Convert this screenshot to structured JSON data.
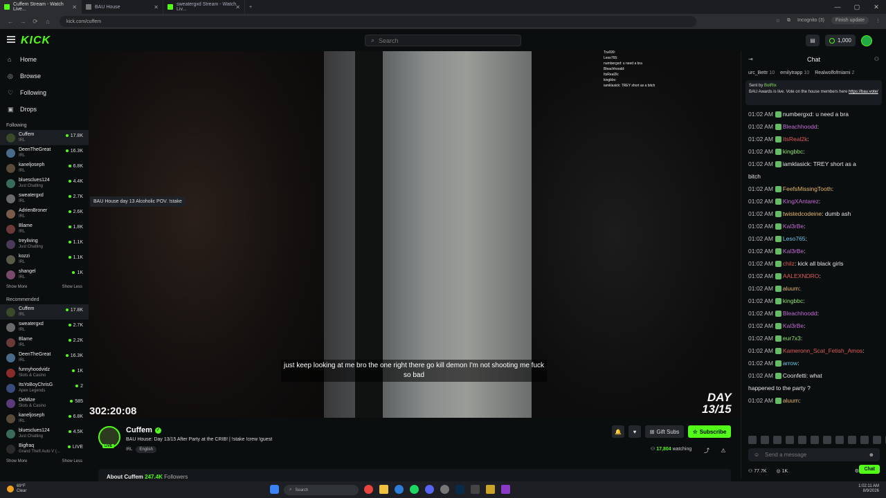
{
  "browser": {
    "tabs": [
      {
        "title": "Cuffem Stream - Watch Live...",
        "active": true
      },
      {
        "title": "BAU House",
        "active": false
      },
      {
        "title": "sweatergxd Stream - Watch Liv...",
        "active": false
      }
    ],
    "url": "kick.com/cuffem",
    "incognito": "Incognito (3)",
    "finish_update": "Finish update"
  },
  "topbar": {
    "logo": "KICK",
    "search_placeholder": "Search",
    "coins": "1,000"
  },
  "nav": [
    {
      "icon": "⌂",
      "label": "Home"
    },
    {
      "icon": "◎",
      "label": "Browse"
    },
    {
      "icon": "♡",
      "label": "Following"
    },
    {
      "icon": "▣",
      "label": "Drops"
    }
  ],
  "following": {
    "heading": "Following",
    "channels": [
      {
        "name": "Cuffem",
        "cat": "IRL",
        "viewers": "17.8K",
        "color": "#3a4a2a"
      },
      {
        "name": "DeenTheGreat",
        "cat": "IRL",
        "viewers": "16.3K",
        "color": "#4a6a8a"
      },
      {
        "name": "kaneljoseph",
        "cat": "IRL",
        "viewers": "6.8K",
        "color": "#5a4a3a"
      },
      {
        "name": "bluesclues124",
        "cat": "Just Chatting",
        "viewers": "4.4K",
        "color": "#3a6a5a"
      },
      {
        "name": "sweatergxd",
        "cat": "IRL",
        "viewers": "2.7K",
        "color": "#6a6a6a"
      },
      {
        "name": "AdrienBroner",
        "cat": "IRL",
        "viewers": "2.6K",
        "color": "#7a5a4a"
      },
      {
        "name": "Blame",
        "cat": "IRL",
        "viewers": "1.8K",
        "color": "#6a3a3a"
      },
      {
        "name": "treyliving",
        "cat": "Just Chatting",
        "viewers": "1.1K",
        "color": "#4a3a5a"
      },
      {
        "name": "kozzi",
        "cat": "IRL",
        "viewers": "1.1K",
        "color": "#5a5a4a"
      },
      {
        "name": "shangel",
        "cat": "IRL",
        "viewers": "1K",
        "color": "#7a4a6a"
      }
    ],
    "show_more": "Show More",
    "show_less": "Show Less"
  },
  "recommended": {
    "heading": "Recommended",
    "channels": [
      {
        "name": "Cuffem",
        "cat": "IRL",
        "viewers": "17.8K",
        "color": "#3a4a2a"
      },
      {
        "name": "sweatergxd",
        "cat": "IRL",
        "viewers": "2.7K",
        "color": "#6a6a6a"
      },
      {
        "name": "Blame",
        "cat": "IRL",
        "viewers": "2.2K",
        "color": "#6a3a3a"
      },
      {
        "name": "DeenTheGreat",
        "cat": "IRL",
        "viewers": "16.3K",
        "color": "#4a6a8a"
      },
      {
        "name": "funnyhoodvidz",
        "cat": "Slots & Casino",
        "viewers": "1K",
        "color": "#8a2a2a"
      },
      {
        "name": "ItsYoBoyChrisG",
        "cat": "Apex Legends",
        "viewers": "2",
        "color": "#3a4a7a"
      },
      {
        "name": "DeMize",
        "cat": "Slots & Casino",
        "viewers": "585",
        "color": "#5a3a7a"
      },
      {
        "name": "kaneljoseph",
        "cat": "IRL",
        "viewers": "6.8K",
        "color": "#5a4a3a"
      },
      {
        "name": "bluesclues124",
        "cat": "Just Chatting",
        "viewers": "4.5K",
        "color": "#3a6a5a"
      },
      {
        "name": "Bigfraq",
        "cat": "Grand Theft Auto V (...",
        "viewers": "LIVE",
        "color": "#2a2a2a"
      }
    ],
    "show_more": "Show More",
    "show_less": "Show Less"
  },
  "video": {
    "tooltip": "BAU House day 13 Alcoholic POV. !stake",
    "caption": "just keep looking at me bro the one right there go kill demon I'm not shooting me fuck so bad",
    "timer": "302:20:08",
    "day_label": "DAY",
    "day_count": "13/15",
    "overlay_lines": [
      "Tru699:",
      "Leso765:",
      "numbergxd: u need a bra",
      "Bleachhoodd:",
      "ItsReal2k:",
      "kingbbc:",
      "iamklasick: TREY short as a bitch"
    ]
  },
  "stream": {
    "name": "Cuffem",
    "live": "LIVE",
    "title": "BAU House: Day 13/15 After Party at the CRIB! | !stake !crew !guest",
    "category": "IRL",
    "language": "English",
    "gift_subs": "Gift Subs",
    "subscribe": "Subscribe",
    "watching_count": "17,804",
    "watching_label": "watching",
    "about_label": "About Cuffem",
    "followers_count": "247.4K",
    "followers_label": "Followers"
  },
  "chat": {
    "title": "Chat",
    "gifters": [
      {
        "name": "urc_Bettr",
        "count": "10"
      },
      {
        "name": "emilytrapp",
        "count": "10"
      },
      {
        "name": "Realwolfofmiami",
        "count": "2"
      }
    ],
    "pinned_by": "Sent by",
    "pinned_sender": "BotRix",
    "pinned_text": "BAU Awards is live. Vote on the house members here",
    "pinned_link": "https://bau.vote/",
    "messages": [
      {
        "time": "01:02 AM",
        "user": "numbergxd",
        "color": "#e6e6e6",
        "text": "u need a bra"
      },
      {
        "time": "01:02 AM",
        "user": "Bleachhoodd",
        "color": "#c46bd6",
        "text": ""
      },
      {
        "time": "01:02 AM",
        "user": "ItsReal2k",
        "color": "#e05a5a",
        "text": ""
      },
      {
        "time": "01:02 AM",
        "user": "kingbbc",
        "color": "#8fe36a",
        "text": ""
      },
      {
        "time": "01:02 AM",
        "user": "iamklasick",
        "color": "#e6e6e6",
        "text": "TREY short as a"
      },
      {
        "time": "",
        "user": "",
        "color": "#e6e6e6",
        "text": "bitch"
      },
      {
        "time": "01:02 AM",
        "user": "FeefsMissingTooth",
        "color": "#e6b86a",
        "text": ""
      },
      {
        "time": "01:02 AM",
        "user": "KingXAntarez",
        "color": "#c46bd6",
        "text": ""
      },
      {
        "time": "01:02 AM",
        "user": "twistedcodeine",
        "color": "#e6b86a",
        "text": "dumb ash"
      },
      {
        "time": "01:02 AM",
        "user": "Kal3rBe",
        "color": "#c46bd6",
        "text": ""
      },
      {
        "time": "01:02 AM",
        "user": "Leso765",
        "color": "#6ac4e6",
        "text": ""
      },
      {
        "time": "01:02 AM",
        "user": "Kal3rBe",
        "color": "#c46bd6",
        "text": ""
      },
      {
        "time": "01:02 AM",
        "user": "chilz",
        "color": "#e05a5a",
        "text": "kick all black girls"
      },
      {
        "time": "01:02 AM",
        "user": "AALEXNDRO",
        "color": "#e05a5a",
        "text": ""
      },
      {
        "time": "01:02 AM",
        "user": "aluum",
        "color": "#e6b86a",
        "text": ""
      },
      {
        "time": "01:02 AM",
        "user": "kingbbc",
        "color": "#8fe36a",
        "text": ""
      },
      {
        "time": "01:02 AM",
        "user": "Bleachhoodd",
        "color": "#c46bd6",
        "text": ""
      },
      {
        "time": "01:02 AM",
        "user": "Kal3rBe",
        "color": "#c46bd6",
        "text": ""
      },
      {
        "time": "01:02 AM",
        "user": "eur7x3",
        "color": "#8fe36a",
        "text": ""
      },
      {
        "time": "01:02 AM",
        "user": "Kameronn_Scat_Fetish_Amos",
        "color": "#e05a5a",
        "text": ""
      },
      {
        "time": "01:02 AM",
        "user": "arrow",
        "color": "#6ac4e6",
        "text": ""
      },
      {
        "time": "01:02 AM",
        "user": "Coonfetti",
        "color": "#e6e6e6",
        "text": "what"
      },
      {
        "time": "",
        "user": "",
        "color": "#e6e6e6",
        "text": "happened to the party ?"
      },
      {
        "time": "01:02 AM",
        "user": "aluum",
        "color": "#e6b86a",
        "text": ""
      }
    ],
    "input_placeholder": "Send a message",
    "footer_count": "77.7K",
    "footer_points": "1K",
    "chat_button": "Chat"
  },
  "taskbar": {
    "temp": "69°F",
    "weather": "Clear",
    "search": "Search",
    "time": "1:02:11 AM",
    "date": "8/9/2026"
  }
}
